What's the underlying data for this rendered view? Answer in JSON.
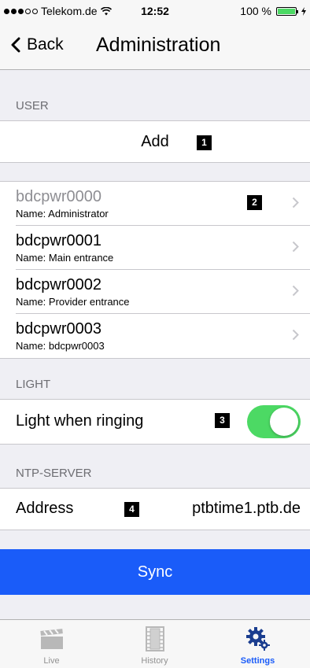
{
  "status_bar": {
    "carrier": "Telekom.de",
    "time": "12:52",
    "battery": "100 %"
  },
  "nav": {
    "back_label": "Back",
    "title": "Administration"
  },
  "sections": {
    "user": {
      "header": "USER",
      "add_label": "Add",
      "badge": "1"
    },
    "users": {
      "badge": "2",
      "items": [
        {
          "id": "bdcpwr0000",
          "name": "Name: Administrator",
          "dimmed": true
        },
        {
          "id": "bdcpwr0001",
          "name": "Name: Main entrance",
          "dimmed": false
        },
        {
          "id": "bdcpwr0002",
          "name": "Name: Provider entrance",
          "dimmed": false
        },
        {
          "id": "bdcpwr0003",
          "name": "Name: bdcpwr0003",
          "dimmed": false
        }
      ]
    },
    "light": {
      "header": "LIGHT",
      "label": "Light when ringing",
      "badge": "3",
      "enabled": true
    },
    "ntp": {
      "header": "NTP-SERVER",
      "address_label": "Address",
      "address_value": "ptbtime1.ptb.de",
      "badge": "4",
      "sync_label": "Sync"
    }
  },
  "tabbar": {
    "items": [
      {
        "label": "Live",
        "icon": "clapperboard-icon",
        "active": false
      },
      {
        "label": "History",
        "icon": "film-strip-icon",
        "active": false
      },
      {
        "label": "Settings",
        "icon": "gears-icon",
        "active": true
      }
    ]
  },
  "colors": {
    "accent": "#1a5cf9",
    "toggle_on": "#4cd964",
    "background": "#efeff4"
  }
}
